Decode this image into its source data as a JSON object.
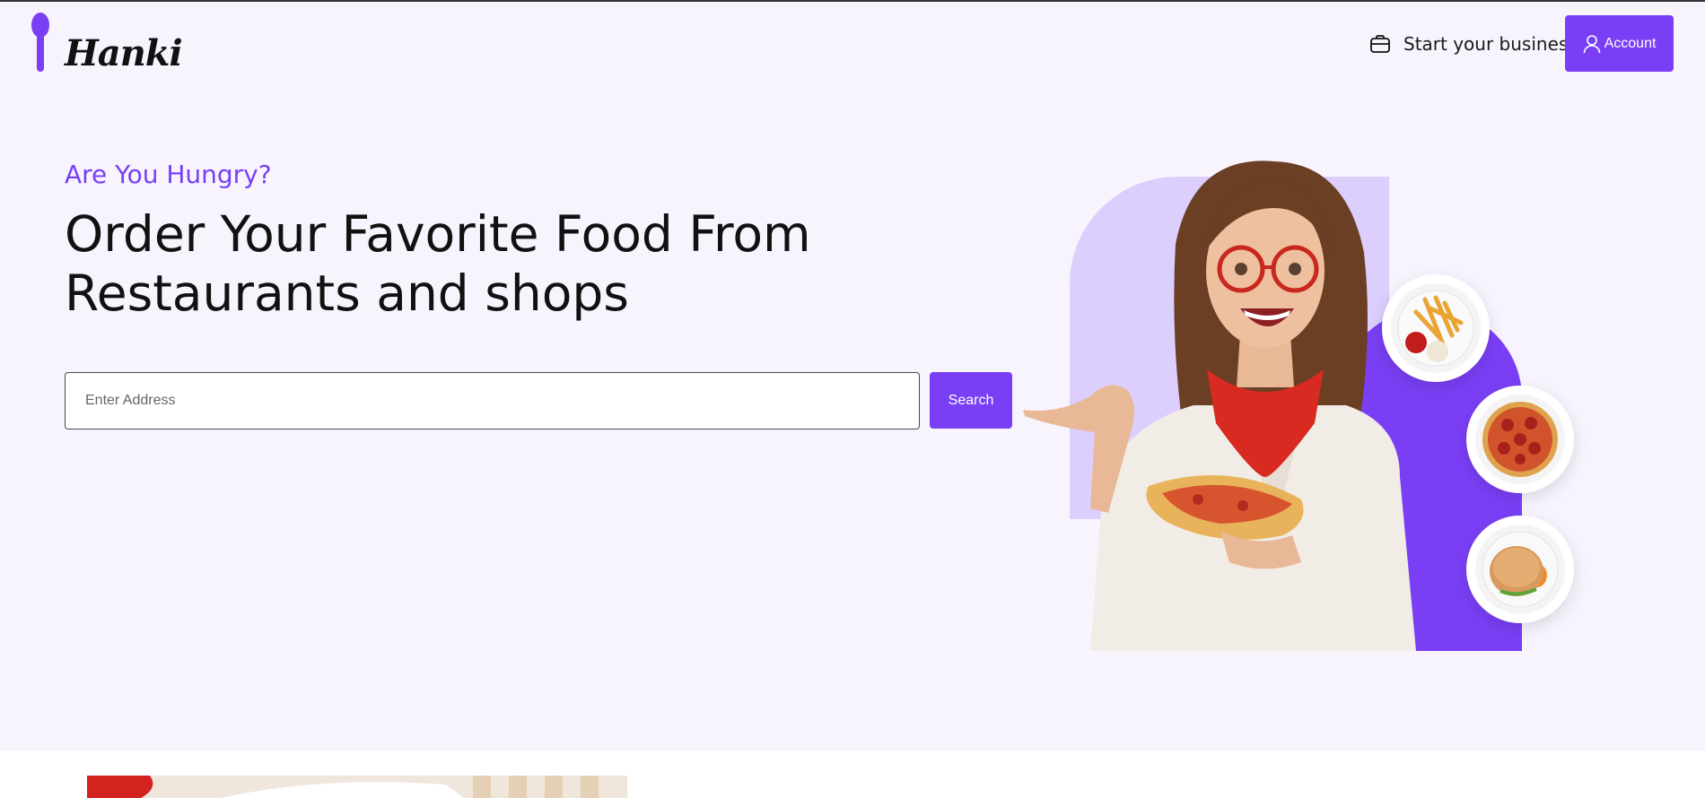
{
  "header": {
    "logo_text": "Hanki",
    "business_link": "Start your business",
    "account_button": "Account"
  },
  "hero": {
    "kicker": "Are You Hungry?",
    "headline_line1": "Order Your Favorite Food From",
    "headline_line2": "Restaurants and shops",
    "address_placeholder": "Enter Address",
    "search_button": "Search"
  },
  "plates": [
    "fries-plate",
    "pizza-plate",
    "burger-plate"
  ],
  "colors": {
    "accent": "#7a3ff5",
    "hero_bg": "#f7f4fe",
    "lavender": "#dccffd"
  },
  "icons": {
    "business": "briefcase-icon",
    "account": "user-icon",
    "logo": "spoon-logo"
  }
}
